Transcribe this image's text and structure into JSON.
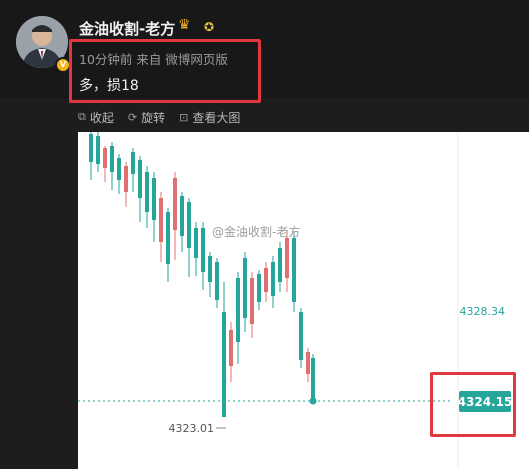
{
  "post": {
    "username": "金油收割-老方",
    "crown_icon": "crown-icon",
    "medal_icon": "medal-icon",
    "time": "10分钟前",
    "source": "来自 微博网页版",
    "content": "多，损18"
  },
  "actions": [
    {
      "label": "收起",
      "icon": "collapse-icon"
    },
    {
      "label": "旋转",
      "icon": "rotate-icon"
    },
    {
      "label": "查看大图",
      "icon": "view-large-icon"
    }
  ],
  "image": {
    "watermark": "@金油收割-老方"
  },
  "chart_data": {
    "type": "candlestick",
    "price_labels": {
      "upper_level": "4328.34",
      "current_price": "4324.15",
      "low_marker": "4323.01"
    },
    "levels": {
      "upper": 4328.34,
      "current": 4324.15,
      "low": 4323.01
    },
    "colors": {
      "up": "#26a69a",
      "down": "#e07070",
      "highlight": "#e0383e"
    }
  }
}
